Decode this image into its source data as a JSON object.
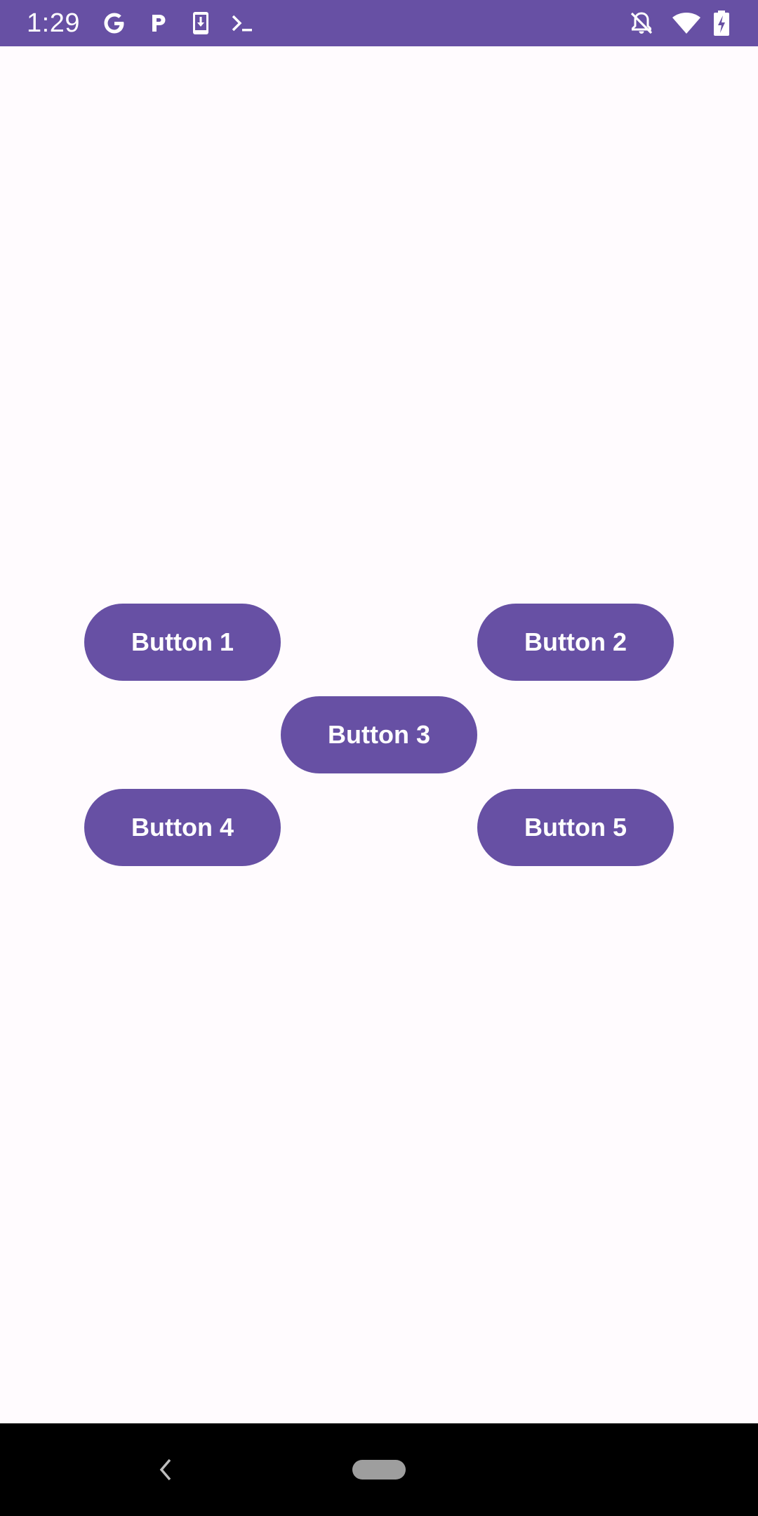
{
  "status_bar": {
    "time": "1:29",
    "background_color": "#6750a4",
    "left_icons": [
      "google-icon",
      "parking-icon",
      "download-icon",
      "terminal-icon"
    ],
    "right_icons": [
      "notifications-off-icon",
      "wifi-icon",
      "battery-charging-icon"
    ]
  },
  "buttons": {
    "button1": "Button 1",
    "button2": "Button 2",
    "button3": "Button 3",
    "button4": "Button 4",
    "button5": "Button 5",
    "color": "#6750a4"
  },
  "nav_bar": {
    "icons": [
      "back-icon",
      "home-pill"
    ]
  }
}
